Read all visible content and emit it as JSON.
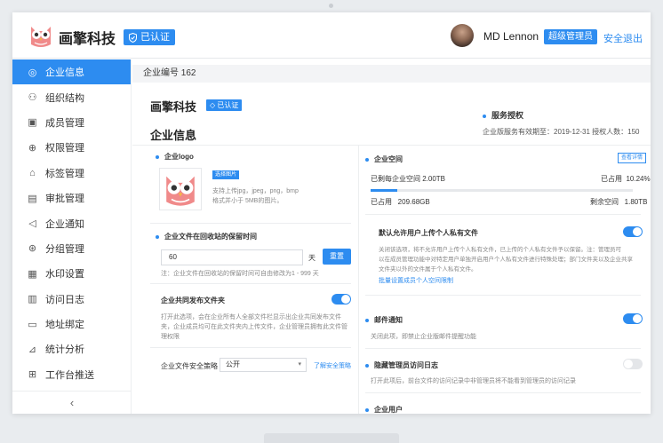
{
  "header": {
    "brand": "画擎科技",
    "verified": "已认证",
    "username": "MD Lennon",
    "role": "超级管理员",
    "logout": "安全退出"
  },
  "sidebar": {
    "items": [
      {
        "label": "企业信息",
        "icon": "company-info-icon",
        "glyph": "◎",
        "active": true
      },
      {
        "label": "组织结构",
        "icon": "org-structure-icon",
        "glyph": "⚇"
      },
      {
        "label": "成员管理",
        "icon": "member-card-icon",
        "glyph": "▣"
      },
      {
        "label": "权限管理",
        "icon": "lock-icon",
        "glyph": "⊕"
      },
      {
        "label": "标签管理",
        "icon": "tag-icon",
        "glyph": "⌂"
      },
      {
        "label": "审批管理",
        "icon": "approval-icon",
        "glyph": "▤"
      },
      {
        "label": "企业通知",
        "icon": "megaphone-icon",
        "glyph": "◁"
      },
      {
        "label": "分组管理",
        "icon": "group-icon",
        "glyph": "⊛"
      },
      {
        "label": "水印设置",
        "icon": "watermark-icon",
        "glyph": "▦"
      },
      {
        "label": "访问日志",
        "icon": "log-icon",
        "glyph": "▥"
      },
      {
        "label": "地址绑定",
        "icon": "mac-icon",
        "glyph": "▭"
      },
      {
        "label": "统计分析",
        "icon": "chart-icon",
        "glyph": "⊿"
      },
      {
        "label": "工作台推送",
        "icon": "workspace-icon",
        "glyph": "⊞"
      }
    ],
    "collapse_icon": "‹"
  },
  "main": {
    "org_number": "企业编号 162",
    "company_name": "画擎科技",
    "verified": "已认证",
    "page_title": "企业信息",
    "service": {
      "title": "服务授权",
      "info": "企业版服务有效期至：2019-12-31    授权人数：150"
    },
    "logo": {
      "title": "企业logo",
      "select_btn": "选择图片",
      "hint_line1": "支持上传jpg，jpeg，png，bmp",
      "hint_line2": "格式并小于 5MB的图片。"
    },
    "recycle": {
      "title": "企业文件在回收站的保留时间",
      "value": "60",
      "unit": "天",
      "reset": "重置",
      "note": "注：企业文件在回收站的保留时间可自由修改为1 - 999 天"
    },
    "shared_publish": {
      "title": "企业共同发布文件夹",
      "desc_line1": "打开此选项，会在企业所有人全部文件栏显示出企业共同发布文件",
      "desc_line2": "夹，企业成员均可在此文件夹内上传文件，企业管理员拥有此文件管",
      "desc_line3": "理权限",
      "enabled": true
    },
    "security": {
      "label": "企业文件安全策略",
      "value": "公开",
      "link": "了解安全策略"
    },
    "space": {
      "title": "企业空间",
      "detail_btn": "查看详情",
      "allocated_label": "已剩每企业空间 2.00TB",
      "used_pct_label": "已占用",
      "used_pct": "10.24%",
      "used_label": "已占用",
      "used_value": "209.68GB",
      "remain_label": "剩余空间",
      "remain_value": "1.80TB",
      "progress": 0.1024
    },
    "private_upload": {
      "title": "默认允许用户上传个人私有文件",
      "desc_line1": "关闭该选项，将不允许用户上传个人私有文件，已上传的个人私有文件予以保留。注：管理员可",
      "desc_line2": "以在成员管理功能中对特定用户单独开启用户个人私有文件进行特殊处理；部门文件夹以及企业共享",
      "desc_line3": "文件夹以外的文件属于个人私有文件。",
      "link": "批量设置成员个人空间限制",
      "enabled": true
    },
    "mail_notice": {
      "title": "邮件通知",
      "desc": "关闭此项，即禁止企业版邮件提醒功能",
      "enabled": true
    },
    "hide_admin_log": {
      "title": "隐藏管理员访问日志",
      "desc": "打开此项后，前台文件的访问记录中非管理员将不能看到管理员的访问记录",
      "enabled": false
    },
    "enterprise_users": {
      "title": "企业用户"
    }
  }
}
